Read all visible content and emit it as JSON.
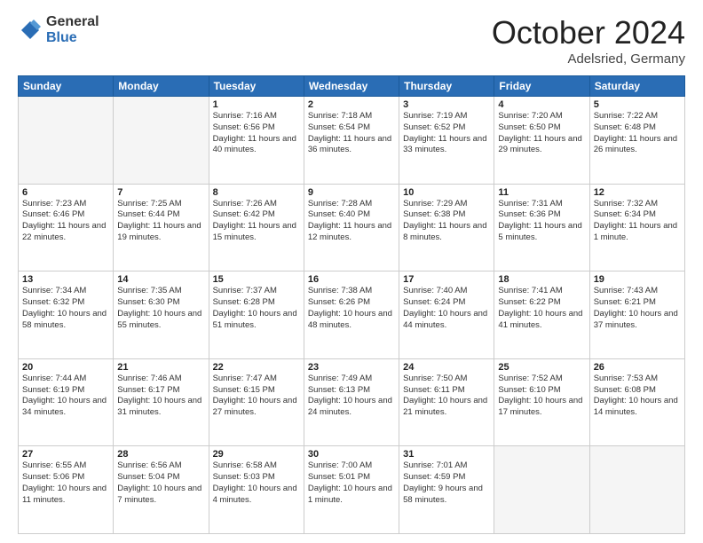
{
  "header": {
    "logo_general": "General",
    "logo_blue": "Blue",
    "month_title": "October 2024",
    "location": "Adelsried, Germany"
  },
  "weekdays": [
    "Sunday",
    "Monday",
    "Tuesday",
    "Wednesday",
    "Thursday",
    "Friday",
    "Saturday"
  ],
  "weeks": [
    [
      {
        "day": "",
        "info": ""
      },
      {
        "day": "",
        "info": ""
      },
      {
        "day": "1",
        "info": "Sunrise: 7:16 AM\nSunset: 6:56 PM\nDaylight: 11 hours and 40 minutes."
      },
      {
        "day": "2",
        "info": "Sunrise: 7:18 AM\nSunset: 6:54 PM\nDaylight: 11 hours and 36 minutes."
      },
      {
        "day": "3",
        "info": "Sunrise: 7:19 AM\nSunset: 6:52 PM\nDaylight: 11 hours and 33 minutes."
      },
      {
        "day": "4",
        "info": "Sunrise: 7:20 AM\nSunset: 6:50 PM\nDaylight: 11 hours and 29 minutes."
      },
      {
        "day": "5",
        "info": "Sunrise: 7:22 AM\nSunset: 6:48 PM\nDaylight: 11 hours and 26 minutes."
      }
    ],
    [
      {
        "day": "6",
        "info": "Sunrise: 7:23 AM\nSunset: 6:46 PM\nDaylight: 11 hours and 22 minutes."
      },
      {
        "day": "7",
        "info": "Sunrise: 7:25 AM\nSunset: 6:44 PM\nDaylight: 11 hours and 19 minutes."
      },
      {
        "day": "8",
        "info": "Sunrise: 7:26 AM\nSunset: 6:42 PM\nDaylight: 11 hours and 15 minutes."
      },
      {
        "day": "9",
        "info": "Sunrise: 7:28 AM\nSunset: 6:40 PM\nDaylight: 11 hours and 12 minutes."
      },
      {
        "day": "10",
        "info": "Sunrise: 7:29 AM\nSunset: 6:38 PM\nDaylight: 11 hours and 8 minutes."
      },
      {
        "day": "11",
        "info": "Sunrise: 7:31 AM\nSunset: 6:36 PM\nDaylight: 11 hours and 5 minutes."
      },
      {
        "day": "12",
        "info": "Sunrise: 7:32 AM\nSunset: 6:34 PM\nDaylight: 11 hours and 1 minute."
      }
    ],
    [
      {
        "day": "13",
        "info": "Sunrise: 7:34 AM\nSunset: 6:32 PM\nDaylight: 10 hours and 58 minutes."
      },
      {
        "day": "14",
        "info": "Sunrise: 7:35 AM\nSunset: 6:30 PM\nDaylight: 10 hours and 55 minutes."
      },
      {
        "day": "15",
        "info": "Sunrise: 7:37 AM\nSunset: 6:28 PM\nDaylight: 10 hours and 51 minutes."
      },
      {
        "day": "16",
        "info": "Sunrise: 7:38 AM\nSunset: 6:26 PM\nDaylight: 10 hours and 48 minutes."
      },
      {
        "day": "17",
        "info": "Sunrise: 7:40 AM\nSunset: 6:24 PM\nDaylight: 10 hours and 44 minutes."
      },
      {
        "day": "18",
        "info": "Sunrise: 7:41 AM\nSunset: 6:22 PM\nDaylight: 10 hours and 41 minutes."
      },
      {
        "day": "19",
        "info": "Sunrise: 7:43 AM\nSunset: 6:21 PM\nDaylight: 10 hours and 37 minutes."
      }
    ],
    [
      {
        "day": "20",
        "info": "Sunrise: 7:44 AM\nSunset: 6:19 PM\nDaylight: 10 hours and 34 minutes."
      },
      {
        "day": "21",
        "info": "Sunrise: 7:46 AM\nSunset: 6:17 PM\nDaylight: 10 hours and 31 minutes."
      },
      {
        "day": "22",
        "info": "Sunrise: 7:47 AM\nSunset: 6:15 PM\nDaylight: 10 hours and 27 minutes."
      },
      {
        "day": "23",
        "info": "Sunrise: 7:49 AM\nSunset: 6:13 PM\nDaylight: 10 hours and 24 minutes."
      },
      {
        "day": "24",
        "info": "Sunrise: 7:50 AM\nSunset: 6:11 PM\nDaylight: 10 hours and 21 minutes."
      },
      {
        "day": "25",
        "info": "Sunrise: 7:52 AM\nSunset: 6:10 PM\nDaylight: 10 hours and 17 minutes."
      },
      {
        "day": "26",
        "info": "Sunrise: 7:53 AM\nSunset: 6:08 PM\nDaylight: 10 hours and 14 minutes."
      }
    ],
    [
      {
        "day": "27",
        "info": "Sunrise: 6:55 AM\nSunset: 5:06 PM\nDaylight: 10 hours and 11 minutes."
      },
      {
        "day": "28",
        "info": "Sunrise: 6:56 AM\nSunset: 5:04 PM\nDaylight: 10 hours and 7 minutes."
      },
      {
        "day": "29",
        "info": "Sunrise: 6:58 AM\nSunset: 5:03 PM\nDaylight: 10 hours and 4 minutes."
      },
      {
        "day": "30",
        "info": "Sunrise: 7:00 AM\nSunset: 5:01 PM\nDaylight: 10 hours and 1 minute."
      },
      {
        "day": "31",
        "info": "Sunrise: 7:01 AM\nSunset: 4:59 PM\nDaylight: 9 hours and 58 minutes."
      },
      {
        "day": "",
        "info": ""
      },
      {
        "day": "",
        "info": ""
      }
    ]
  ]
}
